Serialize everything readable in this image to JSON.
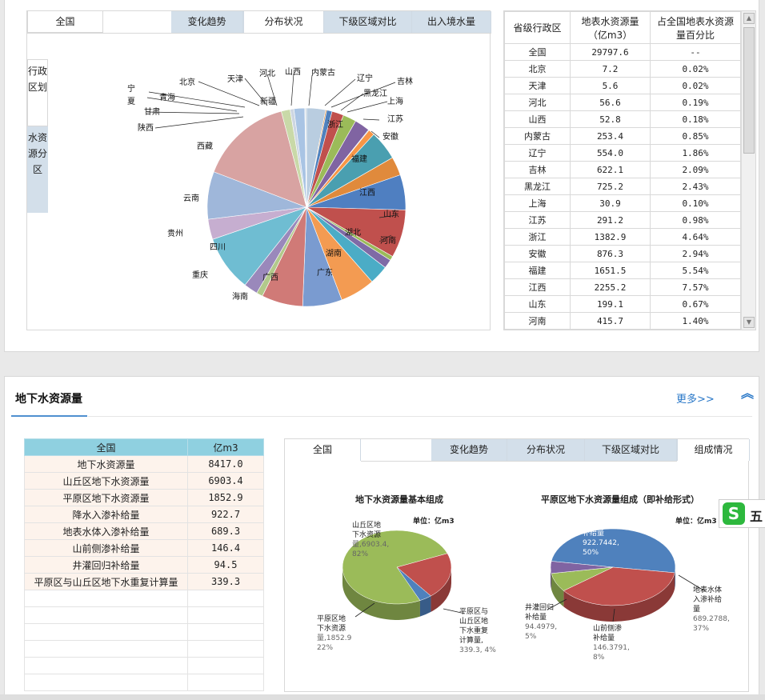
{
  "top": {
    "region_tab": "全国",
    "tabs": [
      "变化趋势",
      "分布状况",
      "下级区域对比",
      "出入境水量"
    ],
    "side_tabs": [
      "行政区划",
      "水资源分区"
    ],
    "pie_labels": [
      "宁夏",
      "北京",
      "天津",
      "河北",
      "山西",
      "内蒙古",
      "辽宁",
      "吉林",
      "黑龙江",
      "上海",
      "江苏",
      "浙江",
      "安徽",
      "福建",
      "江西",
      "山东",
      "河南",
      "湖北",
      "湖南",
      "广东",
      "广西",
      "海南",
      "重庆",
      "四川",
      "贵州",
      "云南",
      "西藏",
      "陕西",
      "甘肃",
      "青海",
      "新疆"
    ],
    "table": {
      "headers": [
        "省级行政区",
        "地表水资源量（亿m3）",
        "占全国地表水资源量百分比"
      ],
      "rows": [
        [
          "全国",
          "29797.6",
          "--"
        ],
        [
          "北京",
          "7.2",
          "0.02%"
        ],
        [
          "天津",
          "5.6",
          "0.02%"
        ],
        [
          "河北",
          "56.6",
          "0.19%"
        ],
        [
          "山西",
          "52.8",
          "0.18%"
        ],
        [
          "内蒙古",
          "253.4",
          "0.85%"
        ],
        [
          "辽宁",
          "554.0",
          "1.86%"
        ],
        [
          "吉林",
          "622.1",
          "2.09%"
        ],
        [
          "黑龙江",
          "725.2",
          "2.43%"
        ],
        [
          "上海",
          "30.9",
          "0.10%"
        ],
        [
          "江苏",
          "291.2",
          "0.98%"
        ],
        [
          "浙江",
          "1382.9",
          "4.64%"
        ],
        [
          "安徽",
          "876.3",
          "2.94%"
        ],
        [
          "福建",
          "1651.5",
          "5.54%"
        ],
        [
          "江西",
          "2255.2",
          "7.57%"
        ],
        [
          "山东",
          "199.1",
          "0.67%"
        ],
        [
          "河南",
          "415.7",
          "1.40%"
        ]
      ]
    }
  },
  "groundwater": {
    "title": "地下水资源量",
    "more": "更多>>",
    "table": {
      "headers": [
        "全国",
        "亿m3"
      ],
      "rows": [
        [
          "地下水资源量",
          "8417.0"
        ],
        [
          "山丘区地下水资源量",
          "6903.4"
        ],
        [
          "平原区地下水资源量",
          "1852.9"
        ],
        [
          "降水入渗补给量",
          "922.7"
        ],
        [
          "地表水体入渗补给量",
          "689.3"
        ],
        [
          "山前侧渗补给量",
          "146.4"
        ],
        [
          "井灌回归补给量",
          "94.5"
        ],
        [
          "平原区与山丘区地下水重复计算量",
          "339.3"
        ]
      ]
    },
    "region_tab": "全国",
    "tabs": [
      "变化趋势",
      "分布状况",
      "下级区域对比",
      "组成情况"
    ],
    "chart1": {
      "title": "地下水资源量基本组成",
      "unit": "单位：亿m3",
      "labels": [
        {
          "lines": [
            "山丘区地",
            "下水资源",
            "量,6903.4,",
            "82%"
          ]
        },
        {
          "lines": [
            "平原区地",
            "下水资源",
            "量,1852.9",
            "22%"
          ]
        },
        {
          "lines": [
            "平原区与",
            "山丘区地",
            "下水重复",
            "计算量,",
            "339.3, 4%"
          ]
        }
      ]
    },
    "chart2": {
      "title": "平原区地下水资源量组成（即补给形式）",
      "unit": "单位：亿m3",
      "labels": [
        {
          "lines": [
            "降水入渗",
            "补给量",
            "922.7442,",
            "50%"
          ]
        },
        {
          "lines": [
            "地表水体",
            "入渗补给",
            "量",
            "689.2788,",
            "37%"
          ]
        },
        {
          "lines": [
            "山前侧渗",
            "补给量",
            "146.3791,",
            "8%"
          ]
        },
        {
          "lines": [
            "井灌回归",
            "补给量",
            "94.4979,",
            "5%"
          ]
        }
      ]
    },
    "badge": "五"
  },
  "chart_data": [
    {
      "type": "pie",
      "title": "",
      "categories": [
        "新疆",
        "山西",
        "内蒙古",
        "辽宁",
        "吉林",
        "黑龙江",
        "上海",
        "江苏",
        "浙江",
        "安徽",
        "福建",
        "江西",
        "山东",
        "河南",
        "湖北",
        "湖南",
        "广东",
        "广西",
        "海南",
        "重庆",
        "四川",
        "贵州",
        "云南",
        "西藏",
        "陕西",
        "甘肃",
        "青海",
        "宁夏",
        "北京",
        "天津",
        "河北"
      ],
      "values": [
        3.0,
        0.18,
        0.85,
        1.86,
        2.09,
        2.43,
        0.1,
        0.98,
        4.64,
        2.94,
        5.54,
        7.57,
        0.67,
        1.4,
        3.0,
        5.5,
        6.2,
        6.5,
        1.0,
        2.2,
        8.8,
        3.2,
        7.5,
        14.6,
        1.4,
        0.6,
        1.7,
        0.03,
        0.02,
        0.02,
        0.19
      ]
    },
    {
      "type": "pie",
      "title": "地下水资源量基本组成",
      "categories": [
        "山丘区地下水资源量",
        "平原区地下水资源量",
        "平原区与山丘区地下水重复计算量"
      ],
      "values": [
        6903.4,
        1852.9,
        339.3
      ]
    },
    {
      "type": "pie",
      "title": "平原区地下水资源量组成（即补给形式）",
      "categories": [
        "降水入渗补给量",
        "地表水体入渗补给量",
        "山前侧渗补给量",
        "井灌回归补给量"
      ],
      "values": [
        922.7442,
        689.2788,
        146.3791,
        94.4979
      ]
    }
  ]
}
